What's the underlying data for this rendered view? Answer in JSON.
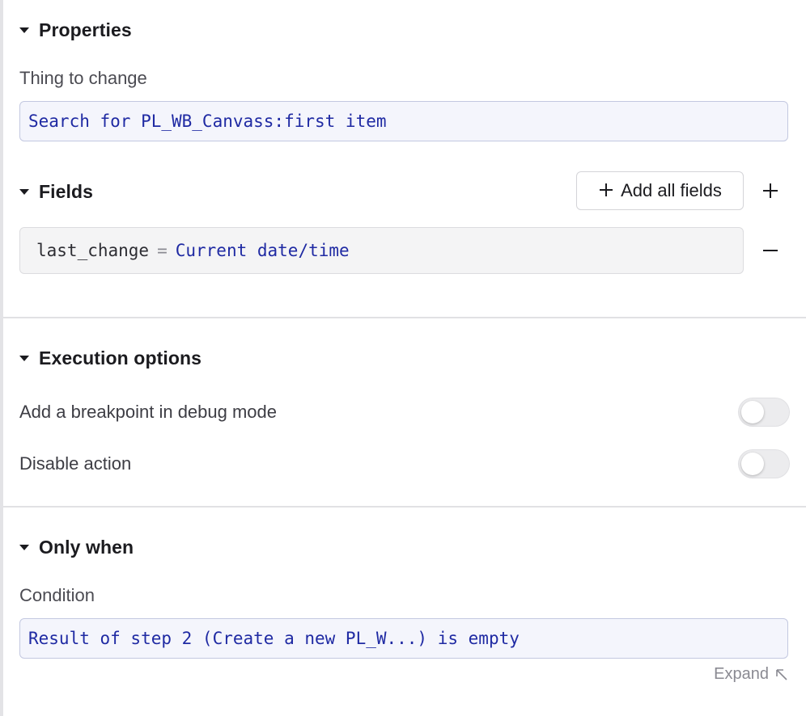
{
  "properties": {
    "title": "Properties",
    "thing_label": "Thing to change",
    "thing_value": "Search for PL_WB_Canvass:first item"
  },
  "fields": {
    "title": "Fields",
    "add_all_label": "Add all fields",
    "rows": [
      {
        "name": "last_change",
        "operator": "=",
        "value": "Current date/time"
      }
    ]
  },
  "execution": {
    "title": "Execution options",
    "breakpoint_label": "Add a breakpoint in debug mode",
    "breakpoint_on": false,
    "disable_label": "Disable action",
    "disable_on": false
  },
  "only_when": {
    "title": "Only when",
    "condition_label": "Condition",
    "condition_value": "Result of step 2 (Create a new PL_W...) is empty",
    "expand_label": "Expand"
  },
  "colors": {
    "code_text": "#1f2aa3",
    "code_field_bg": "#f4f5fc",
    "toggle_off": "#ececee"
  }
}
